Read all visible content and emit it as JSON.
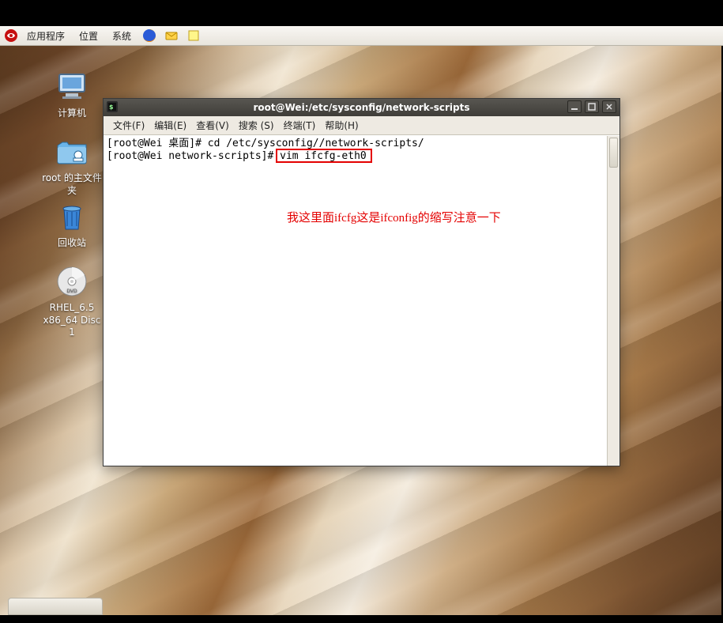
{
  "panel": {
    "menus": [
      "应用程序",
      "位置",
      "系统"
    ],
    "icons": [
      "firefox-icon",
      "mail-icon",
      "notes-icon"
    ]
  },
  "desktop": {
    "computer": "计算机",
    "home": "root 的主文件夹",
    "trash": "回收站",
    "dvd": "RHEL_6.5 x86_64 Disc 1"
  },
  "terminal": {
    "title": "root@Wei:/etc/sysconfig/network-scripts",
    "menus": {
      "file": "文件(F)",
      "edit": "编辑(E)",
      "view": "查看(V)",
      "search": "搜索 (S)",
      "terminal": "终端(T)",
      "help": "帮助(H)"
    },
    "line1": "[root@Wei 桌面]# cd /etc/sysconfig//network-scripts/",
    "line2_prompt": "[root@Wei network-scripts]# ",
    "line2_cmd": "vim ifcfg-eth0 ",
    "annotation": "我这里面ifcfg这是ifconfig的缩写注意一下"
  }
}
